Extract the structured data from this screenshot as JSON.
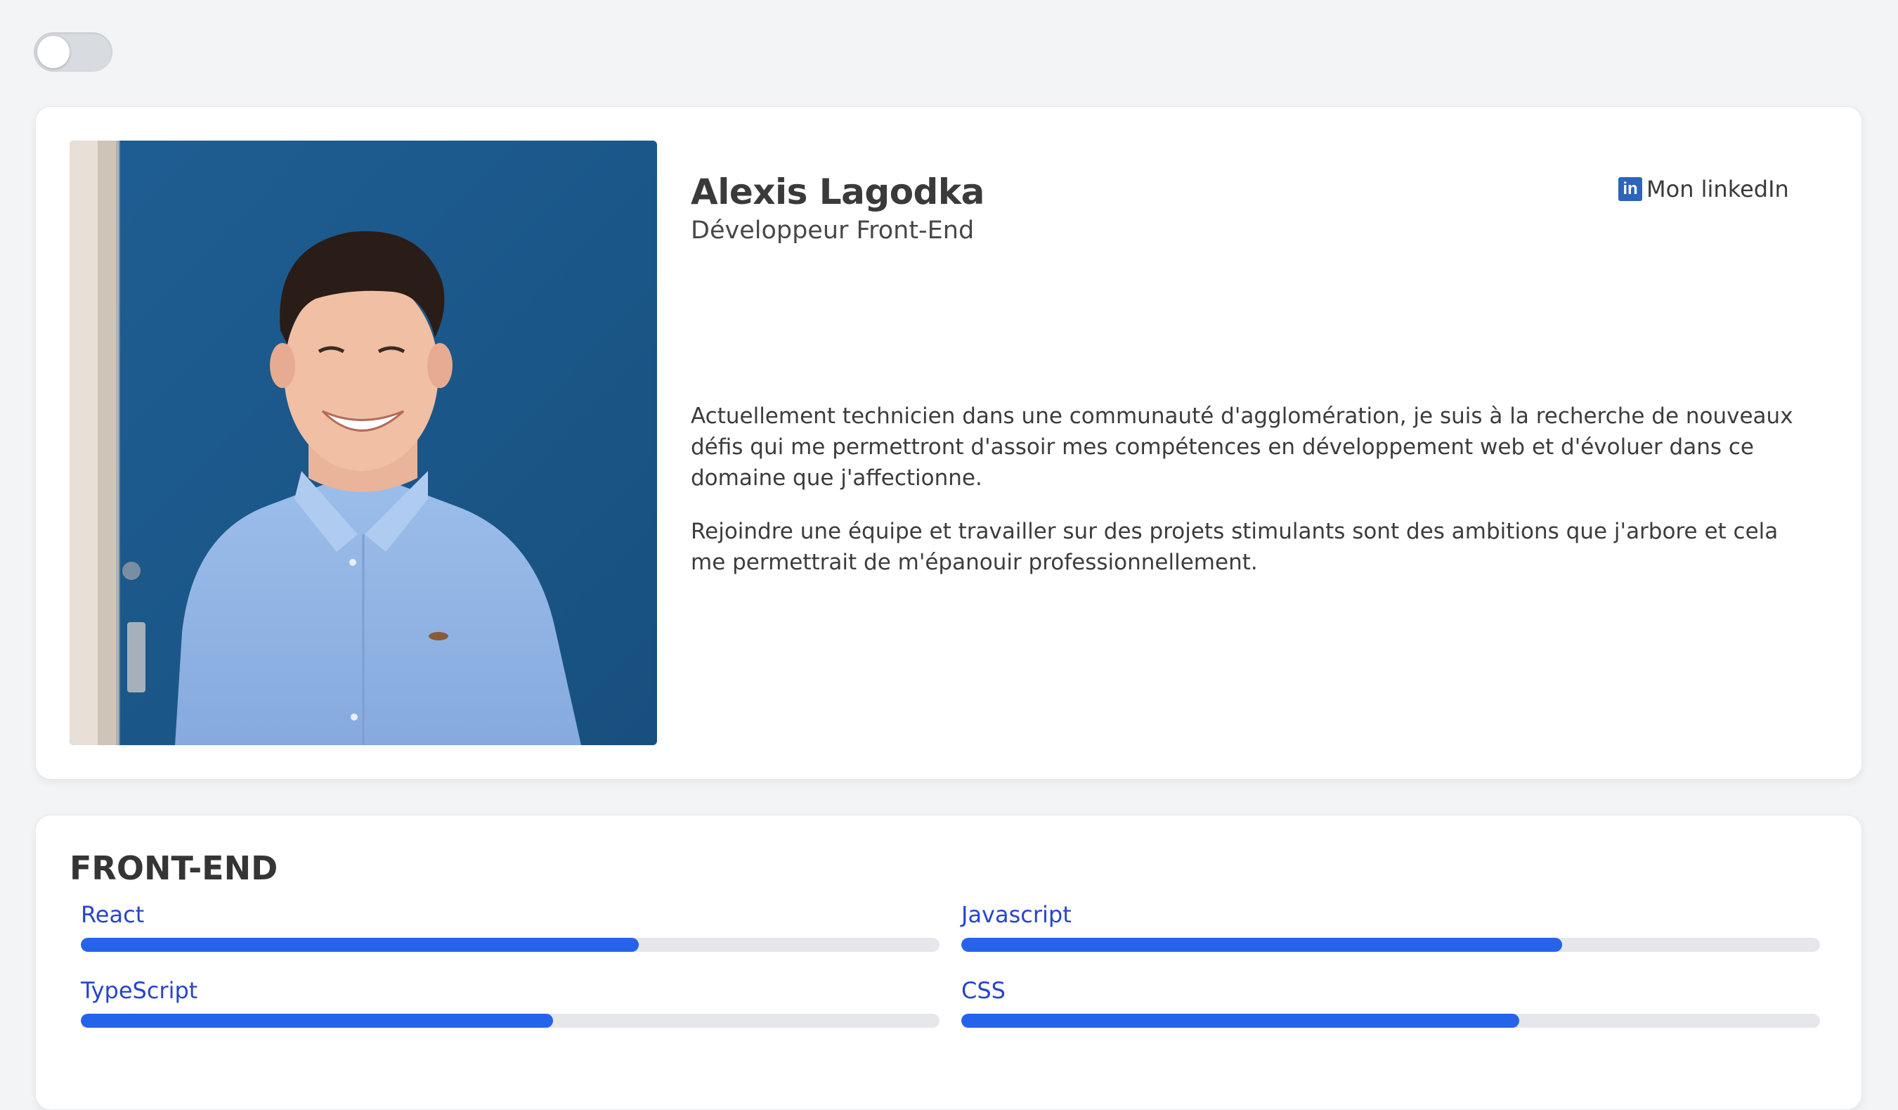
{
  "theme_toggle": {
    "state": "off"
  },
  "profile": {
    "name": "Alexis Lagodka",
    "title": "Développeur Front-End",
    "linkedin": {
      "icon": "linkedin-icon",
      "icon_text": "in",
      "label": "Mon linkedIn"
    },
    "bio": [
      "Actuellement technicien dans une communauté d'agglomération, je suis à la recherche de nouveaux défis qui me permettront d'assoir mes compétences en développement web et d'évoluer dans ce domaine que j'affectionne.",
      "Rejoindre une équipe et travailler sur des projets stimulants sont des ambitions que j'arbore et cela me permettrait de m'épanouir professionnellement."
    ]
  },
  "skills": {
    "section_title": "FRONT-END",
    "items": [
      {
        "label": "React",
        "level": 0.65
      },
      {
        "label": "Javascript",
        "level": 0.7
      },
      {
        "label": "TypeScript",
        "level": 0.55
      },
      {
        "label": "CSS",
        "level": 0.65
      }
    ]
  },
  "colors": {
    "accent": "#2563eb",
    "skill_label": "#2745c9",
    "linkedin": "#2d64bc",
    "background": "#f3f4f6"
  }
}
